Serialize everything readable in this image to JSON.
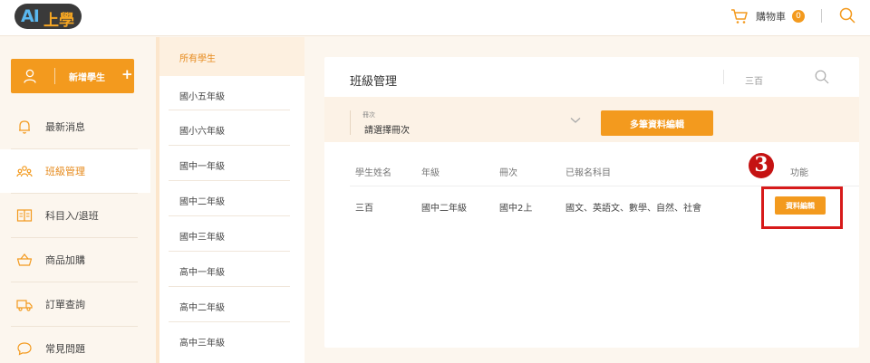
{
  "header": {
    "logo_latin": "AI",
    "logo_cjk": "上學",
    "cart_label": "購物車",
    "cart_count": "0",
    "icons": [
      "cart-icon",
      "search-icon"
    ]
  },
  "sidebar": {
    "add_student_label": "新增學生",
    "add_plus": "+",
    "items": [
      {
        "label": "最新消息",
        "icon": "bell-icon"
      },
      {
        "label": "班級管理",
        "icon": "group-icon"
      },
      {
        "label": "科目入/退班",
        "icon": "book-icon"
      },
      {
        "label": "商品加購",
        "icon": "basket-icon"
      },
      {
        "label": "訂單查詢",
        "icon": "truck-icon"
      },
      {
        "label": "常見問題",
        "icon": "chat-icon"
      }
    ]
  },
  "grades": {
    "items": [
      "所有學生",
      "國小五年級",
      "國小六年級",
      "國中一年級",
      "國中二年級",
      "國中三年級",
      "高中一年級",
      "高中二年級",
      "高中三年級"
    ]
  },
  "main": {
    "title": "班級管理",
    "search_value": "三百",
    "volume_select": {
      "label": "冊次",
      "value": "請選擇冊次"
    },
    "multi_edit_label": "多筆資料編輯",
    "table": {
      "headers": [
        "學生姓名",
        "年級",
        "冊次",
        "已報名科目",
        "功能"
      ],
      "rows": [
        {
          "name": "三百",
          "grade": "國中二年級",
          "volume": "國中2上",
          "subjects": "國文、英語文、數學、自然、社會",
          "action": "資料編輯"
        }
      ]
    },
    "step_marker": "3"
  },
  "colors": {
    "accent": "#f39a1e",
    "highlight": "#d71a1a",
    "background": "#fcf6ee"
  }
}
